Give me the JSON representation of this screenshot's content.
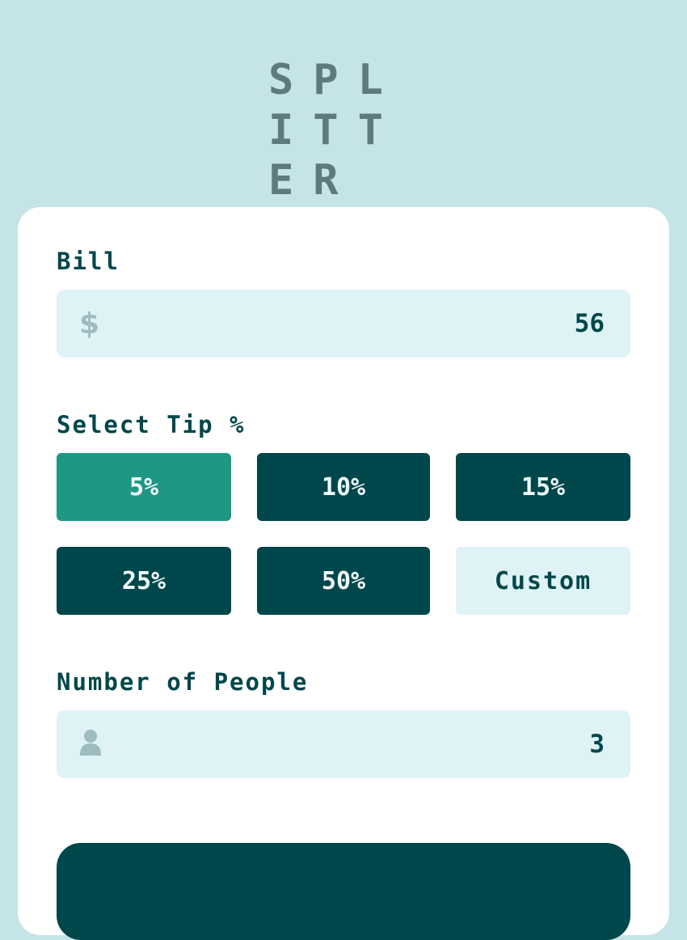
{
  "app": {
    "logo": "SPLITTER"
  },
  "bill": {
    "label": "Bill",
    "currency_icon": "$",
    "value": "56"
  },
  "tip": {
    "label": "Select Tip %",
    "options": [
      "5%",
      "10%",
      "15%",
      "25%",
      "50%"
    ],
    "selected": "5%",
    "custom_label": "Custom"
  },
  "people": {
    "label": "Number of People",
    "value": "3",
    "icon": "person-icon"
  },
  "colors": {
    "background": "#c5e4e7",
    "dark_cyan": "#00474b",
    "active_tip": "#1f9785",
    "input_bg": "#dff3f6"
  }
}
